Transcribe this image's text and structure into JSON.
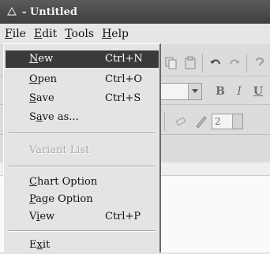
{
  "window": {
    "title": "- Untitled"
  },
  "menubar": [
    {
      "label": "File",
      "ul": "F",
      "rest": "ile"
    },
    {
      "label": "Edit",
      "ul": "E",
      "rest": "dit"
    },
    {
      "label": "Tools",
      "ul": "T",
      "rest": "ools"
    },
    {
      "label": "Help",
      "ul": "H",
      "rest": "elp"
    }
  ],
  "file_menu": {
    "new": {
      "ul": "N",
      "rest": "ew",
      "shortcut": "Ctrl+N"
    },
    "open": {
      "ul": "O",
      "rest": "pen",
      "shortcut": "Ctrl+O"
    },
    "save": {
      "ul": "S",
      "rest": "ave",
      "shortcut": "Ctrl+S"
    },
    "save_as": {
      "pre": "S",
      "ul": "a",
      "rest": "ve as..."
    },
    "variant_list": {
      "label": "Variant List"
    },
    "chart_option": {
      "ul": "C",
      "rest": "hart Option"
    },
    "page_option": {
      "ul": "P",
      "rest": "age Option"
    },
    "view": {
      "pre": "V",
      "ul": "i",
      "rest": "ew",
      "shortcut": "Ctrl+P"
    },
    "exit": {
      "pre": "E",
      "ul": "x",
      "rest": "it"
    }
  },
  "format": {
    "bold": "B",
    "italic": "I",
    "underline": "U"
  },
  "spin_value": "2",
  "colors": {
    "selection": "#3a3a3a",
    "title_bar": "#4a4a4a",
    "menu_bg": "#e4e4e4"
  }
}
